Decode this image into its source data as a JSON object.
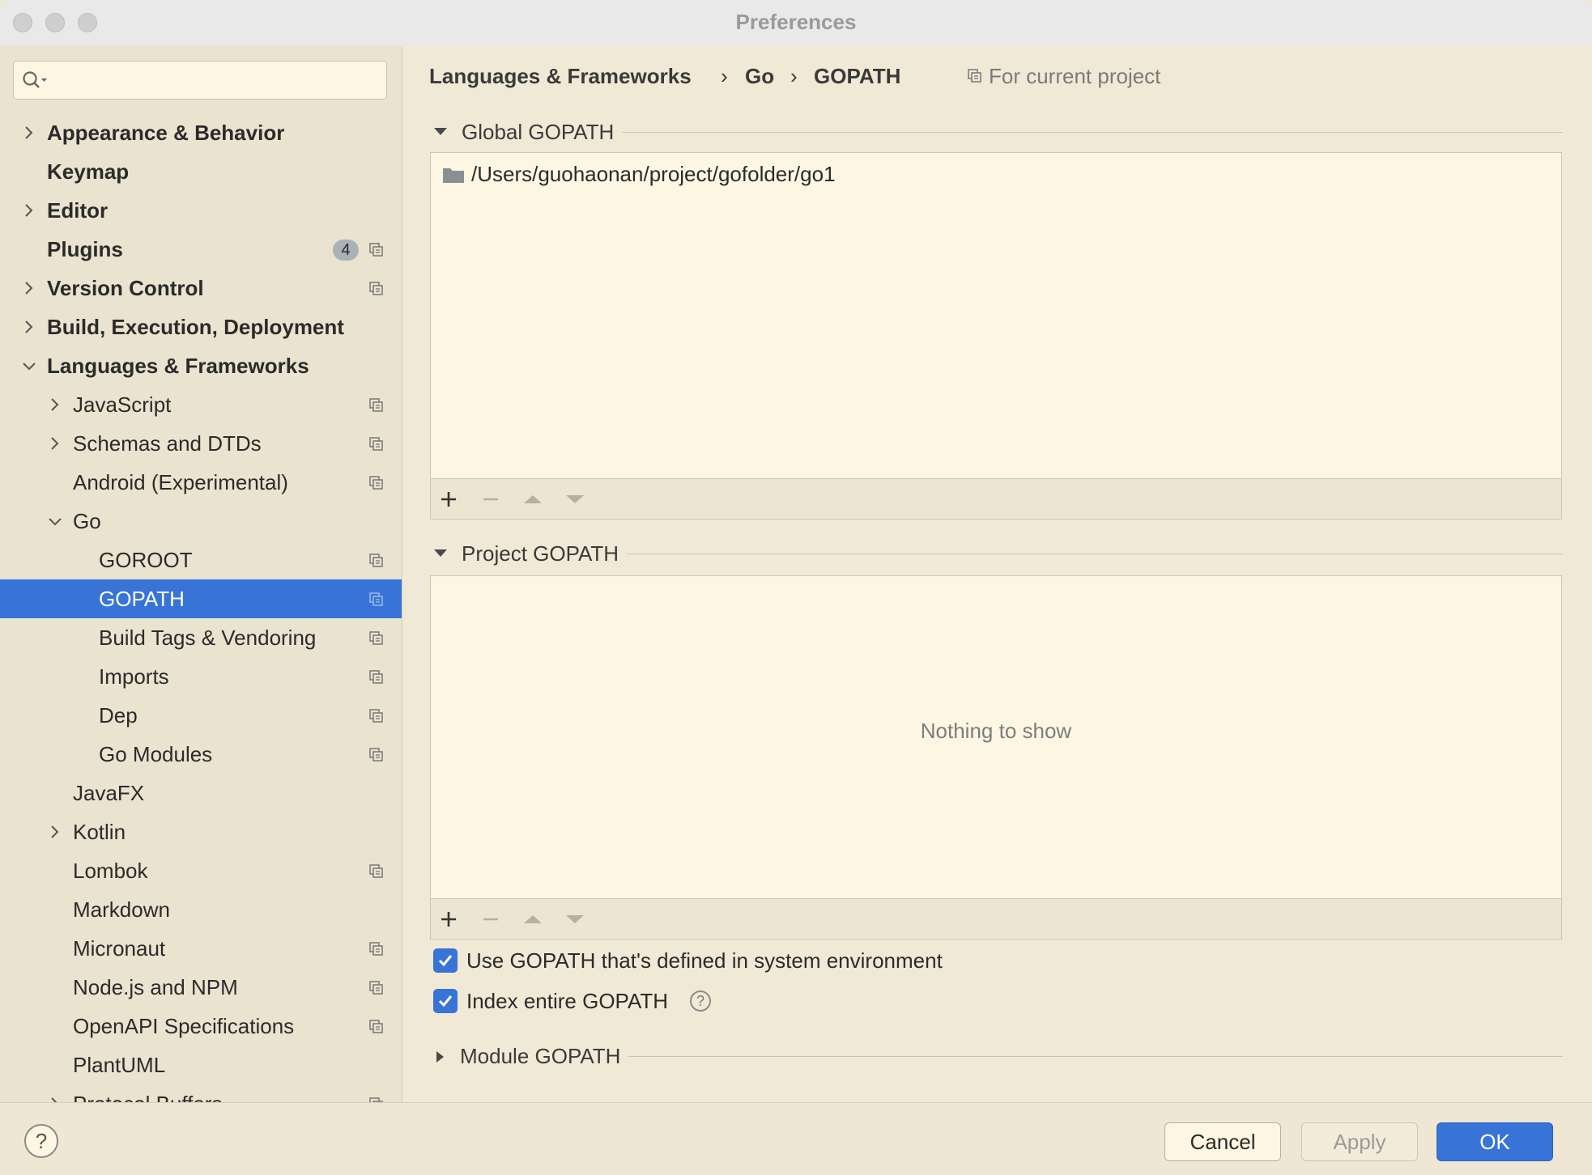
{
  "window": {
    "title": "Preferences"
  },
  "search": {
    "placeholder": ""
  },
  "sidebar": {
    "items": [
      {
        "label": "Appearance & Behavior"
      },
      {
        "label": "Keymap"
      },
      {
        "label": "Editor"
      },
      {
        "label": "Plugins",
        "badge": "4"
      },
      {
        "label": "Version Control"
      },
      {
        "label": "Build, Execution, Deployment"
      },
      {
        "label": "Languages & Frameworks"
      },
      {
        "label": "JavaScript"
      },
      {
        "label": "Schemas and DTDs"
      },
      {
        "label": "Android (Experimental)"
      },
      {
        "label": "Go"
      },
      {
        "label": "GOROOT"
      },
      {
        "label": "GOPATH"
      },
      {
        "label": "Build Tags & Vendoring"
      },
      {
        "label": "Imports"
      },
      {
        "label": "Dep"
      },
      {
        "label": "Go Modules"
      },
      {
        "label": "JavaFX"
      },
      {
        "label": "Kotlin"
      },
      {
        "label": "Lombok"
      },
      {
        "label": "Markdown"
      },
      {
        "label": "Micronaut"
      },
      {
        "label": "Node.js and NPM"
      },
      {
        "label": "OpenAPI Specifications"
      },
      {
        "label": "PlantUML"
      },
      {
        "label": "Protocol Buffers"
      }
    ]
  },
  "breadcrumb": {
    "part1": "Languages & Frameworks",
    "sep": "›",
    "part2": "Go",
    "part3": "GOPATH",
    "scope": "For current project"
  },
  "global_gopath": {
    "title": "Global GOPATH",
    "entries": [
      "/Users/guohaonan/project/gofolder/go1"
    ]
  },
  "project_gopath": {
    "title": "Project GOPATH",
    "empty_text": "Nothing to show"
  },
  "options": {
    "use_system_env": {
      "label": "Use GOPATH that's defined in system environment",
      "checked": true
    },
    "index_entire": {
      "label": "Index entire GOPATH",
      "checked": true
    }
  },
  "module_gopath": {
    "title": "Module GOPATH"
  },
  "footer": {
    "help": "?",
    "cancel": "Cancel",
    "apply": "Apply",
    "ok": "OK"
  },
  "colors": {
    "accent": "#3874d8",
    "panel_bg": "#f0e9d6",
    "list_bg": "#fdf6e3"
  }
}
